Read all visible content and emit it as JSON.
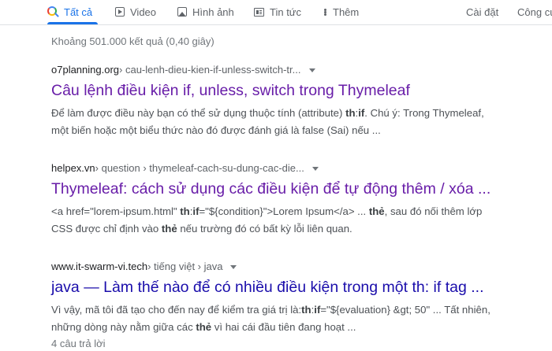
{
  "tabs": {
    "all": "Tất cả",
    "video": "Video",
    "images": "Hình ảnh",
    "news": "Tin tức",
    "more": "Thêm",
    "settings": "Cài đặt",
    "tools": "Công cụ"
  },
  "colors": {
    "accent": "#1a73e8",
    "link_visited": "#681da8",
    "link": "#1a0dab"
  },
  "stats": "Khoảng 501.000 kết quả (0,40 giây)",
  "results": [
    {
      "site": "o7planning.org",
      "path": " › cau-lenh-dieu-kien-if-unless-switch-tr...",
      "title": "Câu lệnh điều kiện if, unless, switch trong Thymeleaf",
      "s1a": "Để làm được điều này bạn có thể sử dụng thuộc tính (attribute) ",
      "s1b": "th",
      "s1c": ":",
      "s1d": "if",
      "s1e": ". Chú ý: Trong Thymeleaf,",
      "s2": "một biến hoặc một biểu thức nào đó được đánh giá là false (Sai) nếu ..."
    },
    {
      "site": "helpex.vn",
      "path": " › question › thymeleaf-cach-su-dung-cac-die...",
      "title": "Thymeleaf: cách sử dụng các điều kiện để tự động thêm / xóa ...",
      "s1a": "<a href=\"lorem-ipsum.html\" ",
      "s1b": "th",
      "s1c": ":",
      "s1d": "if",
      "s1e": "=\"${condition}\">Lorem Ipsum</a> ... ",
      "s1f": "thẻ",
      "s1g": ", sau đó nối thêm lớp",
      "s2a": "CSS được chỉ định vào ",
      "s2b": "thẻ",
      "s2c": " nếu trường đó có bất kỳ lỗi liên quan."
    },
    {
      "site": "www.it-swarm-vi.tech",
      "path": " › tiếng việt › java",
      "title": "java — Làm thế nào để có nhiều điều kiện trong một th: if tag ...",
      "s1a": "Vì vậy, mã tôi đã tạo cho đến nay để kiểm tra giá trị là:",
      "s1b": "th",
      "s1c": ":",
      "s1d": "if",
      "s1e": "=\"${evaluation} &gt; 50\" ... Tất nhiên,",
      "s2a": "những dòng này nằm giữa các ",
      "s2b": "thẻ",
      "s2c": " vì hai cái đầu tiên đang hoạt ...",
      "meta": "4 câu trả lời"
    }
  ]
}
